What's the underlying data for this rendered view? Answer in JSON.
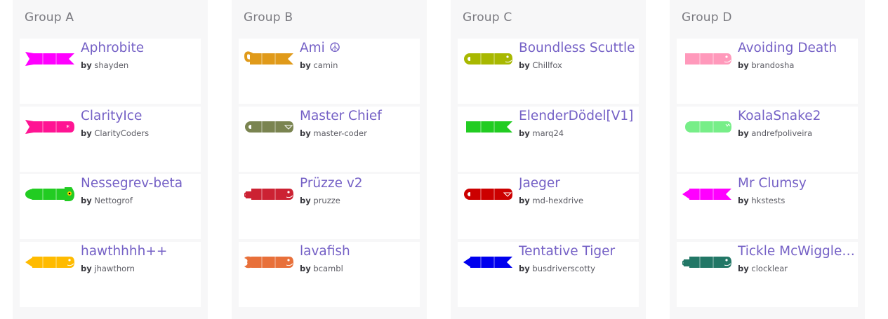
{
  "by_label": "by",
  "groups": [
    {
      "title": "Group A",
      "snakes": [
        {
          "name": "Aphrobite",
          "author": "shayden",
          "color": "#ff00ff",
          "head": "fork",
          "tail": "fork"
        },
        {
          "name": "ClarityIce",
          "author": "ClarityCoders",
          "color": "#ff1493",
          "head": "snow",
          "tail": "fork"
        },
        {
          "name": "Nessegrev-beta",
          "author": "Nettogrof",
          "color": "#22cc22",
          "head": "eye",
          "tail": "leaf"
        },
        {
          "name": "hawthhhh++",
          "author": "jhawthorn",
          "color": "#ffbb00",
          "head": "round",
          "tail": "point"
        }
      ]
    },
    {
      "title": "Group B",
      "snakes": [
        {
          "name": "Ami ☮",
          "author": "camin",
          "color": "#e09a1a",
          "head": "fork",
          "tail": "curl"
        },
        {
          "name": "Master Chief",
          "author": "master-coder",
          "color": "#7a8450",
          "head": "visor",
          "tail": "gear"
        },
        {
          "name": "Prüzze v2",
          "author": "pruzze",
          "color": "#cc2233",
          "head": "round",
          "tail": "mug"
        },
        {
          "name": "lavafish",
          "author": "bcambl",
          "color": "#e8703a",
          "head": "round",
          "tail": "flame"
        }
      ]
    },
    {
      "title": "Group C",
      "snakes": [
        {
          "name": "Boundless Scuttle",
          "author": "Chillfox",
          "color": "#a8b800",
          "head": "round",
          "tail": "gear"
        },
        {
          "name": "ElenderDödel[V1]",
          "author": "marq24",
          "color": "#22cc22",
          "head": "fork",
          "tail": "flat"
        },
        {
          "name": "Jaeger",
          "author": "md-hexdrive",
          "color": "#cc0000",
          "head": "visor",
          "tail": "gear"
        },
        {
          "name": "Tentative Tiger",
          "author": "busdriverscotty",
          "color": "#0000ee",
          "head": "fork",
          "tail": "arrow"
        }
      ]
    },
    {
      "title": "Group D",
      "snakes": [
        {
          "name": "Avoiding Death",
          "author": "brandosha",
          "color": "#ff99bb",
          "head": "round",
          "tail": "flat"
        },
        {
          "name": "KoalaSnake2",
          "author": "andrefpoliveira",
          "color": "#77ee88",
          "head": "teeth",
          "tail": "roundtail"
        },
        {
          "name": "Mr Clumsy",
          "author": "hkstests",
          "color": "#ff00ff",
          "head": "fork",
          "tail": "arrow"
        },
        {
          "name": "Tickle McWiggleton",
          "author": "clocklear",
          "color": "#227766",
          "head": "round",
          "tail": "mug"
        }
      ]
    }
  ]
}
